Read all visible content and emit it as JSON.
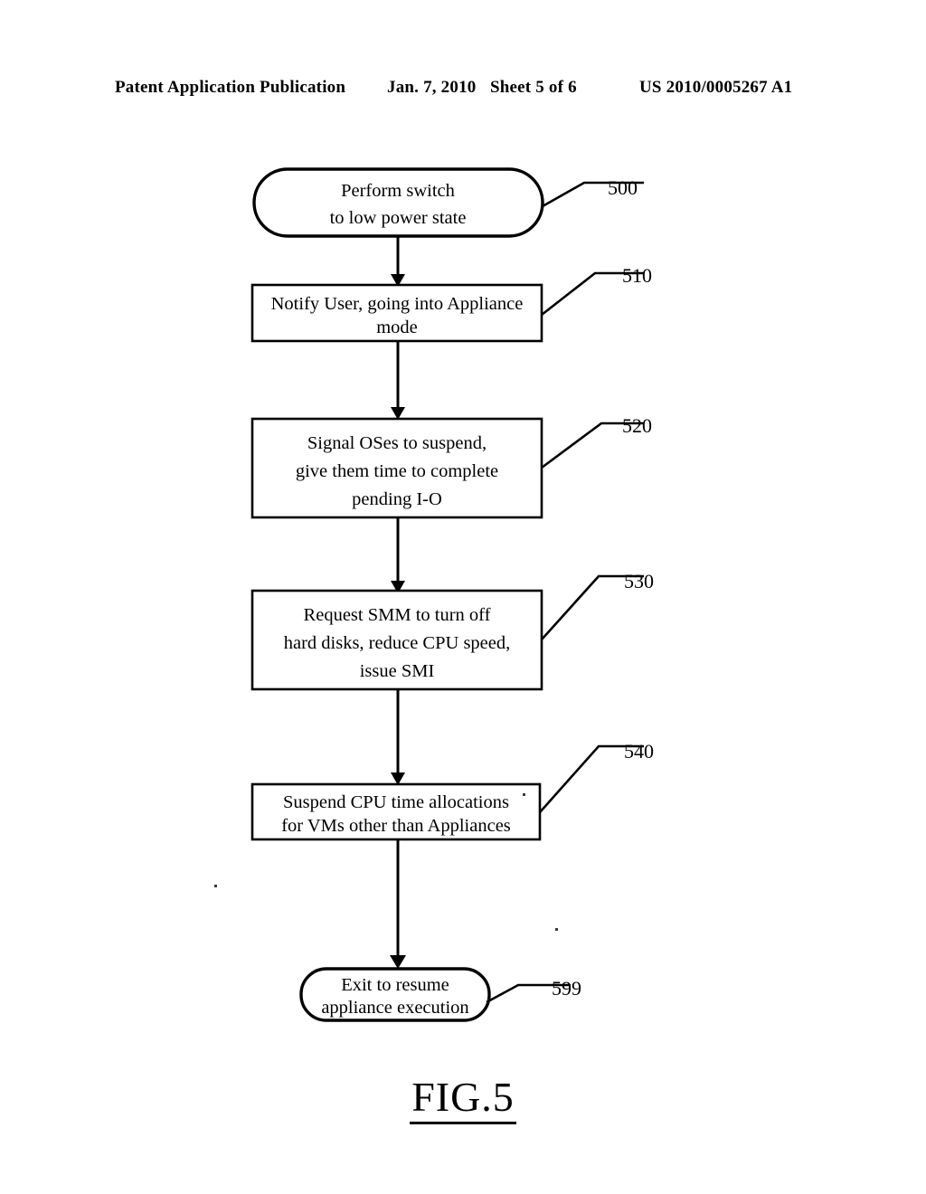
{
  "header": {
    "publication": "Patent Application Publication",
    "date": "Jan. 7, 2010",
    "sheet": "Sheet 5 of 6",
    "patent_number": "US 2010/0005267 A1"
  },
  "figure": {
    "caption": "FIG.5",
    "nodes": [
      {
        "ref": "500",
        "shape": "stadium",
        "lines": [
          "Perform switch",
          "to low power state"
        ]
      },
      {
        "ref": "510",
        "shape": "rectangle",
        "lines": [
          "Notify User, going into Appliance",
          "mode"
        ]
      },
      {
        "ref": "520",
        "shape": "rectangle",
        "lines": [
          "Signal OSes to suspend,",
          "give them time to complete",
          "pending I-O"
        ]
      },
      {
        "ref": "530",
        "shape": "rectangle",
        "lines": [
          "Request SMM to turn off",
          "hard disks, reduce CPU speed,",
          "issue SMI"
        ]
      },
      {
        "ref": "540",
        "shape": "rectangle",
        "lines": [
          "Suspend CPU time allocations",
          "for VMs other than Appliances"
        ]
      },
      {
        "ref": "599",
        "shape": "stadium",
        "lines": [
          "Exit to resume",
          "appliance execution"
        ]
      }
    ]
  },
  "colors": {
    "ink": "#000000",
    "paper": "#ffffff"
  }
}
